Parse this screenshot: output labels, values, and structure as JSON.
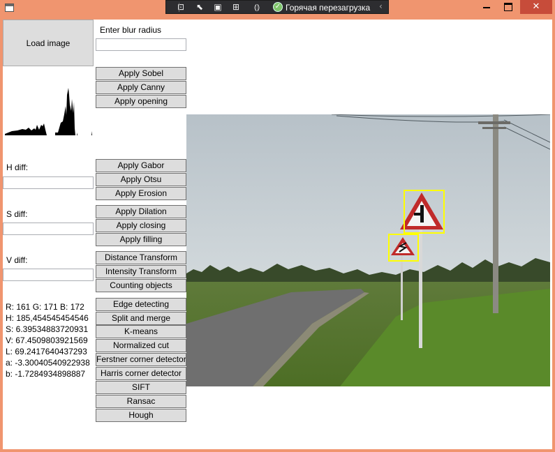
{
  "devbar": {
    "hot_reload_label": "Горячая перезагрузка"
  },
  "controls": {
    "load_image": "Load image",
    "blur_label": "Enter blur radius",
    "blur_value": "",
    "h_diff_label": "H diff:",
    "h_diff_value": "",
    "s_diff_label": "S diff:",
    "s_diff_value": "",
    "v_diff_label": "V diff:",
    "v_diff_value": ""
  },
  "buttons": [
    "Apply Sobel",
    "Apply Canny",
    "Apply opening",
    "Apply Gabor",
    "Apply Otsu",
    "Apply Erosion",
    "Apply Dilation",
    "Apply closing",
    "Apply filling",
    "Distance Transform",
    "Intensity Transform",
    "Counting objects",
    "Edge detecting",
    "Split and merge",
    "K-means",
    "Normalized cut",
    "Ferstner corner detector",
    "Harris corner detector",
    "SIFT",
    "Ransac",
    "Hough"
  ],
  "stats": [
    "R: 161 G: 171 B: 172",
    "H: 185,454545454546",
    "S: 6.39534883720931",
    "V: 67.4509803921569",
    "L: 69.2417640437293",
    "a: -3.30040540922938",
    "b: -1.7284934898887"
  ],
  "icons": {
    "app": "app-window-icon",
    "select_element": "select-element-icon",
    "pointer": "pointer-icon",
    "layout_adorner": "layout-adorner-icon",
    "track_focus": "track-focus-icon",
    "binding_failures": "binding-failures-icon",
    "hot_reload_status": "check-circle-icon",
    "collapse": "chevron-left-icon"
  },
  "colors": {
    "title_bar": "#f0956f",
    "close_button": "#c74c3a",
    "button_face": "#dddddd",
    "detection_box": "#ffff00",
    "devbar": "#2d2d30"
  }
}
